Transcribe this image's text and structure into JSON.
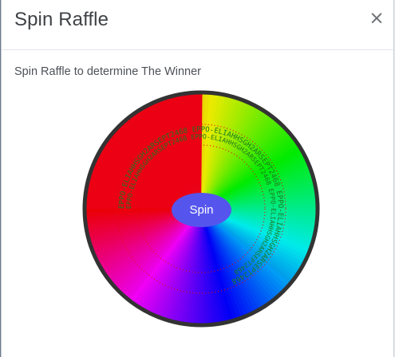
{
  "modal": {
    "title": "Spin Raffle",
    "close_label": "×",
    "instruction": "Spin Raffle to determine The Winner"
  },
  "wheel": {
    "spin_label": "Spin",
    "spin_color": "#5555ee",
    "rim_color": "#333333",
    "entries_color": "#1f7a1f",
    "ring_color": "#e01010",
    "visible_entry": "EPPO-ELIAHHSGH2ARSEPT2468"
  }
}
